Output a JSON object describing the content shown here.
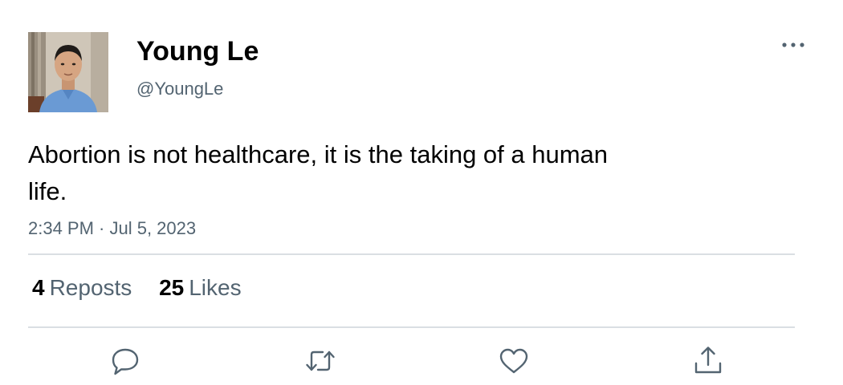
{
  "author": {
    "display_name": "Young Le",
    "handle": "@YoungLe",
    "avatar_icon": "profile-photo"
  },
  "tweet": {
    "text": "Abortion is not healthcare, it is the taking of a human life.",
    "timestamp": "2:34 PM · Jul 5, 2023"
  },
  "stats": {
    "reposts": {
      "count": "4",
      "label": "Reposts"
    },
    "likes": {
      "count": "25",
      "label": "Likes"
    }
  },
  "actions": [
    {
      "name": "reply",
      "icon": "reply-icon"
    },
    {
      "name": "repost",
      "icon": "repost-icon"
    },
    {
      "name": "like",
      "icon": "heart-icon"
    },
    {
      "name": "share",
      "icon": "share-icon"
    }
  ],
  "colors": {
    "text": "#0f1419",
    "secondary": "#536471",
    "divider": "#dadfe3"
  }
}
